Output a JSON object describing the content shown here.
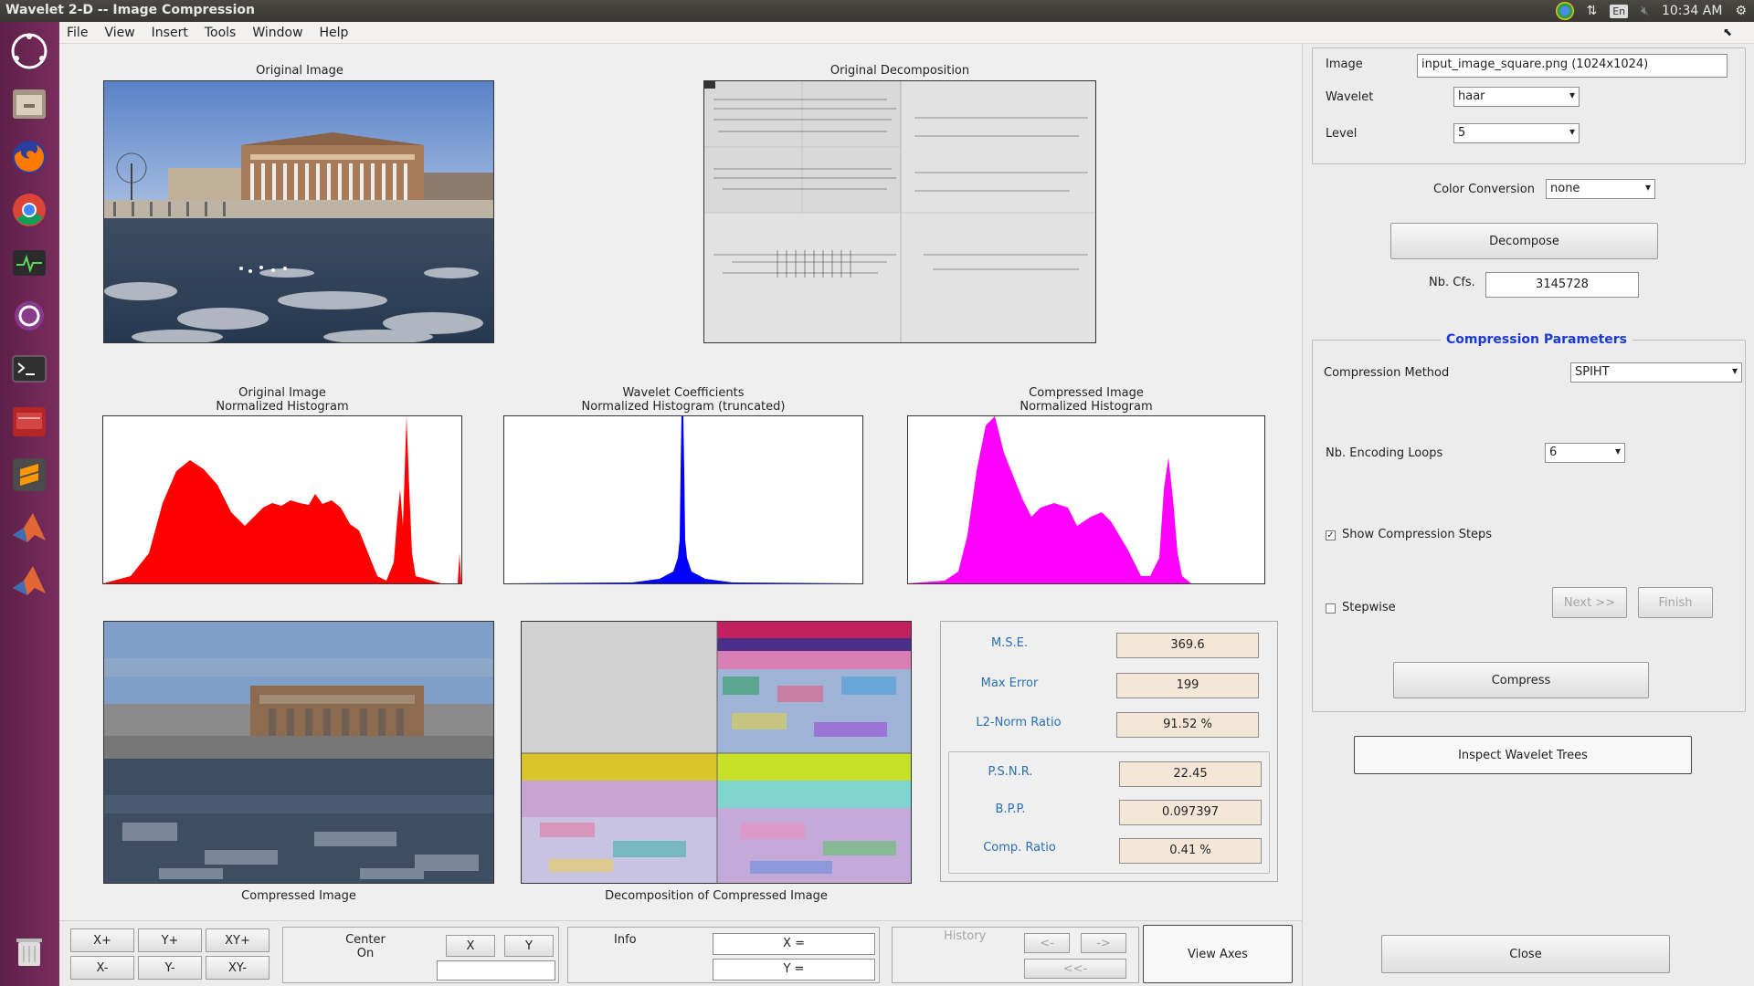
{
  "window": {
    "title": "Wavelet 2-D -- Image Compression"
  },
  "tray": {
    "lang": "En",
    "time": "10:34 AM"
  },
  "menu": [
    "File",
    "View",
    "Insert",
    "Tools",
    "Window",
    "Help"
  ],
  "launcher": [
    "ubuntu-icon",
    "files-icon",
    "firefox-icon",
    "chrome-icon",
    "system-monitor-icon",
    "settings-icon",
    "terminal-icon",
    "presentation-icon",
    "sublime-icon",
    "matlab-icon",
    "matlab-icon",
    "trash-icon"
  ],
  "captions": {
    "original_image": "Original Image",
    "original_decomposition": "Original Decomposition",
    "hist_original_1": "Original Image",
    "hist_original_2": "Normalized Histogram",
    "hist_wavelet_1": "Wavelet Coefficients",
    "hist_wavelet_2": "Normalized Histogram (truncated)",
    "hist_compressed_1": "Compressed Image",
    "hist_compressed_2": "Normalized Histogram",
    "compressed_image": "Compressed Image",
    "decomposition_compressed": "Decomposition of Compressed Image"
  },
  "colors": {
    "hist_original": "#ff0000",
    "hist_wavelet": "#0000ff",
    "hist_compressed": "#ff00ff",
    "stat_label": "#2a6fb5",
    "stat_value_bg": "#f4e7d7",
    "section_title": "#1c39d4"
  },
  "stats": {
    "mse_label": "M.S.E.",
    "mse": "369.6",
    "maxerr_label": "Max Error",
    "maxerr": "199",
    "l2_label": "L2-Norm Ratio",
    "l2": "91.52 %",
    "psnr_label": "P.S.N.R.",
    "psnr": "22.45",
    "bpp_label": "B.P.P.",
    "bpp": "0.097397",
    "cr_label": "Comp. Ratio",
    "cr": "0.41 %"
  },
  "controls": {
    "image_label": "Image",
    "image_value": "input_image_square.png  (1024x1024)",
    "wavelet_label": "Wavelet",
    "wavelet_value": "haar",
    "level_label": "Level",
    "level_value": "5",
    "color_conv_label": "Color Conversion",
    "color_conv_value": "none",
    "decompose": "Decompose",
    "nbcfs_label": "Nb. Cfs.",
    "nbcfs_value": "3145728",
    "compression_title": "Compression Parameters",
    "method_label": "Compression Method",
    "method_value": "SPIHT",
    "loops_label": "Nb. Encoding Loops",
    "loops_value": "6",
    "show_steps_label": "Show Compression Steps",
    "show_steps_checked": true,
    "stepwise_label": "Stepwise",
    "stepwise_checked": false,
    "next": "Next >>",
    "finish": "Finish",
    "compress": "Compress",
    "inspect": "Inspect Wavelet Trees",
    "close": "Close"
  },
  "bottom": {
    "xplus": "X+",
    "yplus": "Y+",
    "xyplus": "XY+",
    "xminus": "X-",
    "yminus": "Y-",
    "xyminus": "XY-",
    "center_label": "Center\nOn",
    "center_x": "X",
    "center_y": "Y",
    "info_label": "Info",
    "info_x": "X =",
    "info_y": "Y =",
    "history_label": "History",
    "hist_back": "<-",
    "hist_fwd": "->",
    "hist_first": "<<-",
    "view_axes": "View Axes"
  }
}
